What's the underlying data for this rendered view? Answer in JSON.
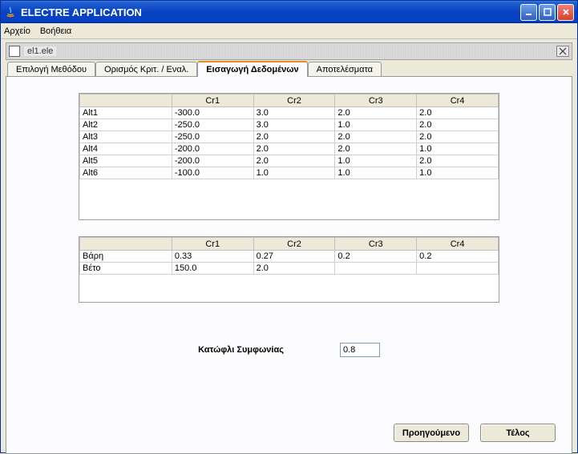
{
  "window": {
    "title": "ELECTRE APPLICATION"
  },
  "menu": {
    "file": "Αρχείο",
    "help": "Βοήθεια"
  },
  "internal": {
    "filename": "el1.ele"
  },
  "tabs": {
    "t1": "Επιλογή Μεθόδου",
    "t2": "Ορισμός Κριτ. / Εναλ.",
    "t3": "Εισαγωγή Δεδομένων",
    "t4": "Αποτελέσματα"
  },
  "criteria_headers": {
    "blank": "",
    "c1": "Cr1",
    "c2": "Cr2",
    "c3": "Cr3",
    "c4": "Cr4"
  },
  "alts": [
    {
      "name": "Alt1",
      "c1": "-300.0",
      "c2": "3.0",
      "c3": "2.0",
      "c4": "2.0"
    },
    {
      "name": "Alt2",
      "c1": "-250.0",
      "c2": "3.0",
      "c3": "1.0",
      "c4": "2.0"
    },
    {
      "name": "Alt3",
      "c1": "-250.0",
      "c2": "2.0",
      "c3": "2.0",
      "c4": "2.0"
    },
    {
      "name": "Alt4",
      "c1": "-200.0",
      "c2": "2.0",
      "c3": "2.0",
      "c4": "1.0"
    },
    {
      "name": "Alt5",
      "c1": "-200.0",
      "c2": "2.0",
      "c3": "1.0",
      "c4": "2.0"
    },
    {
      "name": "Alt6",
      "c1": "-100.0",
      "c2": "1.0",
      "c3": "1.0",
      "c4": "1.0"
    }
  ],
  "params": [
    {
      "name": "Βάρη",
      "c1": "0.33",
      "c2": "0.27",
      "c3": "0.2",
      "c4": "0.2"
    },
    {
      "name": "Βέτο",
      "c1": "150.0",
      "c2": "2.0",
      "c3": "",
      "c4": ""
    }
  ],
  "threshold": {
    "label": "Κατώφλι Συμφωνίας",
    "value": "0.8"
  },
  "buttons": {
    "prev": "Προηγούμενο",
    "finish": "Τέλος"
  },
  "chart_data": {
    "type": "table",
    "title": "ELECTRE data entry",
    "criteria": [
      "Cr1",
      "Cr2",
      "Cr3",
      "Cr4"
    ],
    "alternatives": {
      "Alt1": [
        -300.0,
        3.0,
        2.0,
        2.0
      ],
      "Alt2": [
        -250.0,
        3.0,
        1.0,
        2.0
      ],
      "Alt3": [
        -250.0,
        2.0,
        2.0,
        2.0
      ],
      "Alt4": [
        -200.0,
        2.0,
        2.0,
        1.0
      ],
      "Alt5": [
        -200.0,
        2.0,
        1.0,
        2.0
      ],
      "Alt6": [
        -100.0,
        1.0,
        1.0,
        1.0
      ]
    },
    "weights": [
      0.33,
      0.27,
      0.2,
      0.2
    ],
    "veto": [
      150.0,
      2.0,
      null,
      null
    ],
    "concordance_threshold": 0.8
  }
}
